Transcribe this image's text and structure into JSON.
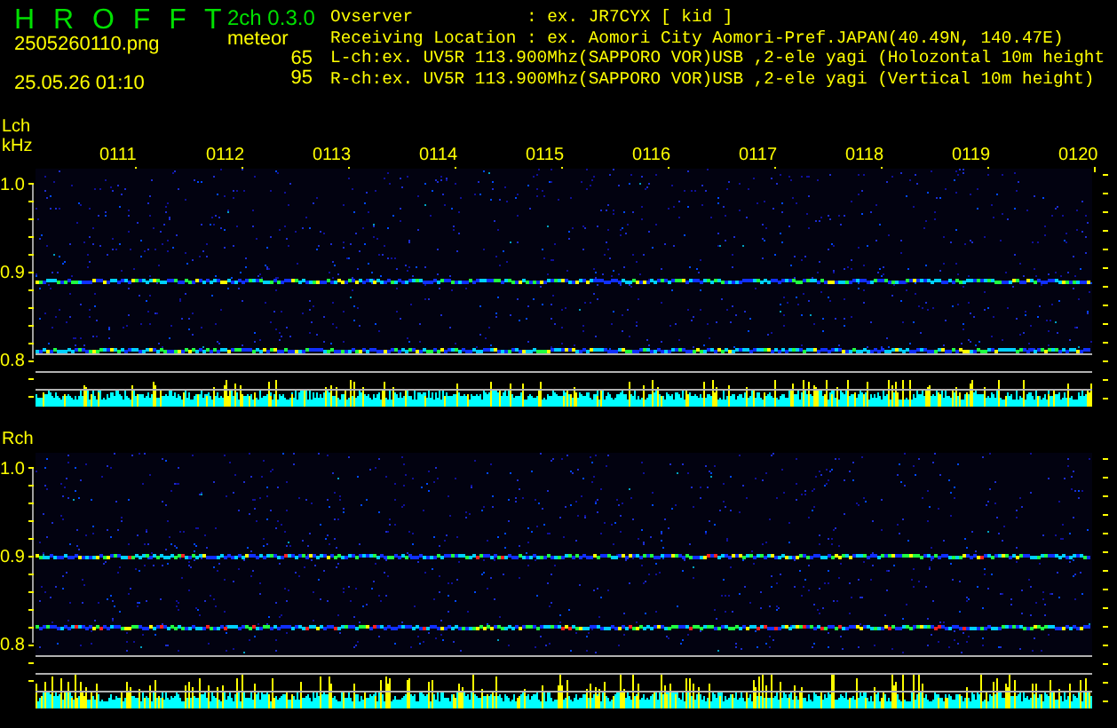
{
  "header": {
    "title": "H R O F F T",
    "version": "2ch 0.3.0",
    "file_name": "2505260110.png",
    "timestamp": "25.05.26 01:10",
    "meteor_label": "meteor",
    "meteor_counts": [
      "65",
      "95"
    ]
  },
  "station_info": {
    "observer": {
      "label": "Ovserver",
      "value": ": ex. JR7CYX [ kid ]"
    },
    "location": {
      "label": "Receiving Location",
      "value": ": ex. Aomori City Aomori-Pref.JAPAN(40.49N, 140.47E)"
    },
    "channels": [
      "L-ch:ex. UV5R 113.900Mhz(SAPPORO VOR)USB ,2-ele yagi (Holozontal 10m height",
      "R-ch:ex. UV5R 113.900Mhz(SAPPORO VOR)USB ,2-ele yagi (Vertical 10m height)"
    ]
  },
  "panels": [
    {
      "channel": "Lch",
      "unit": "kHz",
      "time_labels": [
        "0111",
        "0112",
        "0113",
        "0114",
        "0115",
        "0116",
        "0117",
        "0118",
        "0119",
        "0120"
      ],
      "y_labels": [
        "1.0",
        "0.9",
        "0.8"
      ]
    },
    {
      "channel": "Rch",
      "y_labels": [
        "1.0",
        "0.9",
        "0.8"
      ]
    }
  ]
}
